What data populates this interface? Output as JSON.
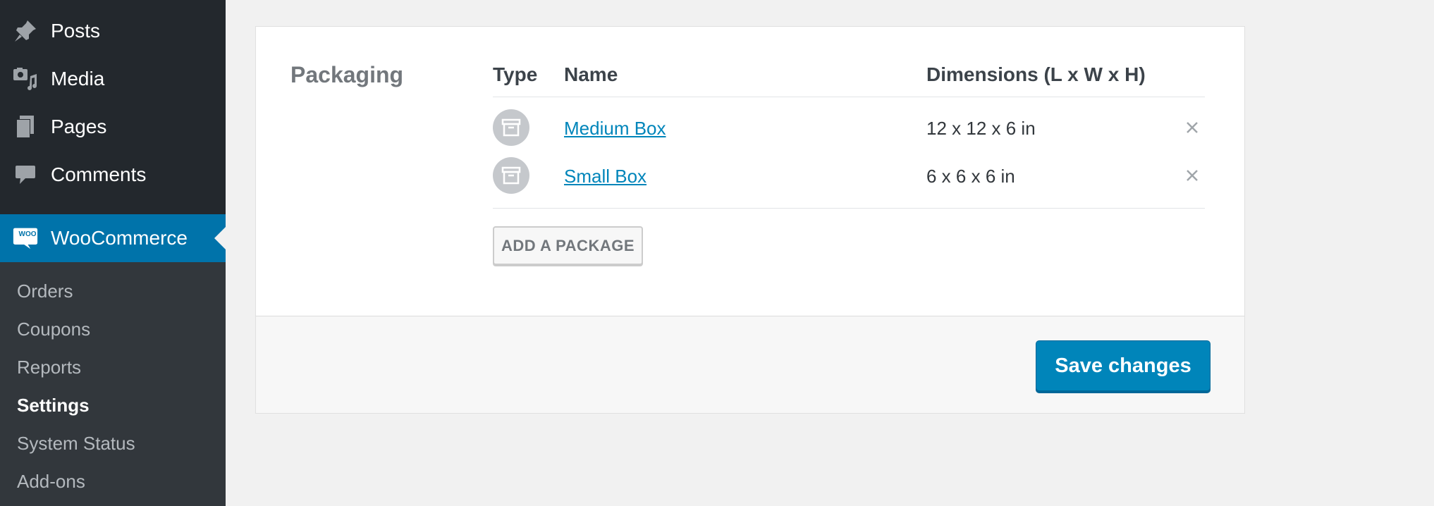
{
  "sidebar": {
    "menu": [
      {
        "label": "Posts",
        "icon": "pin-icon"
      },
      {
        "label": "Media",
        "icon": "media-icon"
      },
      {
        "label": "Pages",
        "icon": "pages-icon"
      },
      {
        "label": "Comments",
        "icon": "comment-icon"
      }
    ],
    "active": {
      "label": "WooCommerce",
      "icon_text": "WOO"
    },
    "submenu": [
      {
        "label": "Orders"
      },
      {
        "label": "Coupons"
      },
      {
        "label": "Reports"
      },
      {
        "label": "Settings",
        "current": true
      },
      {
        "label": "System Status"
      },
      {
        "label": "Add-ons"
      }
    ]
  },
  "packaging": {
    "section_label": "Packaging",
    "columns": {
      "type": "Type",
      "name": "Name",
      "dimensions": "Dimensions (L x W x H)"
    },
    "packages": [
      {
        "name": "Medium Box",
        "dimensions": "12 x 12 x 6 in",
        "type_icon": "box-icon"
      },
      {
        "name": "Small Box",
        "dimensions": "6 x 6 x 6 in",
        "type_icon": "box-icon"
      }
    ],
    "add_button": "ADD A PACKAGE"
  },
  "footer": {
    "save_button": "Save changes"
  },
  "colors": {
    "sidebar_bg": "#23282d",
    "submenu_bg": "#32373c",
    "active": "#0073aa",
    "link": "#0085ba",
    "primary_button": "#0085ba"
  }
}
